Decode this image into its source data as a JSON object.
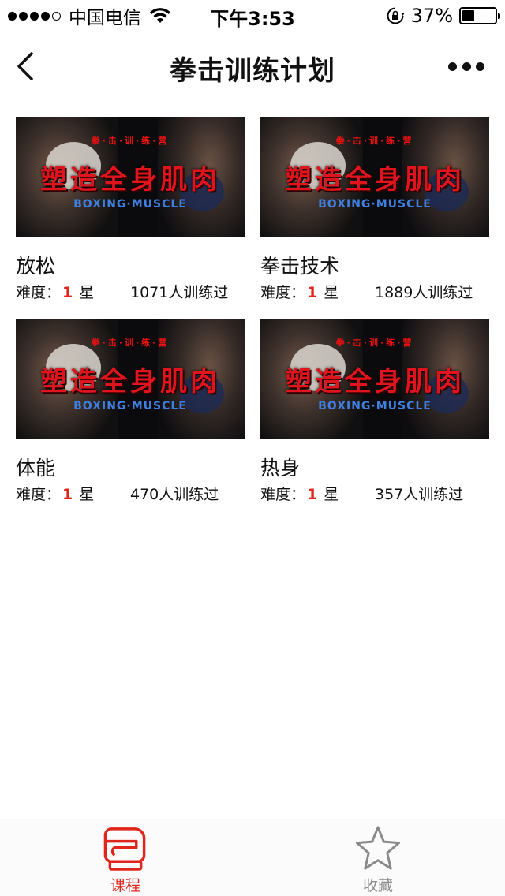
{
  "status_bar": {
    "carrier": "中国电信",
    "time": "下午3:53",
    "battery_percent": "37%",
    "battery_level": 0.37,
    "icons": [
      "signal-dots",
      "wifi-icon",
      "rotation-lock-icon",
      "battery-icon"
    ]
  },
  "nav": {
    "title": "拳击训练计划",
    "back_icon": "chevron-left-icon",
    "more_icon": "more-dots-icon"
  },
  "thumbnail": {
    "small_text": "拳·击·训·练·营",
    "big_text": "塑造全身肌肉",
    "english": "BOXING·MUSCLE"
  },
  "courses": [
    {
      "title": "放松",
      "difficulty_label": "难度：",
      "stars": "1",
      "star_unit": "星",
      "count": "1071人训练过"
    },
    {
      "title": "拳击技术",
      "difficulty_label": "难度：",
      "stars": "1",
      "star_unit": "星",
      "count": "1889人训练过"
    },
    {
      "title": "体能",
      "difficulty_label": "难度：",
      "stars": "1",
      "star_unit": "星",
      "count": "470人训练过"
    },
    {
      "title": "热身",
      "difficulty_label": "难度：",
      "stars": "1",
      "star_unit": "星",
      "count": "357人训练过"
    }
  ],
  "tabbar": {
    "courses_label": "课程",
    "favorites_label": "收藏",
    "active": "courses"
  },
  "colors": {
    "accent": "#e0261c",
    "inactive": "#8a8a8a"
  }
}
